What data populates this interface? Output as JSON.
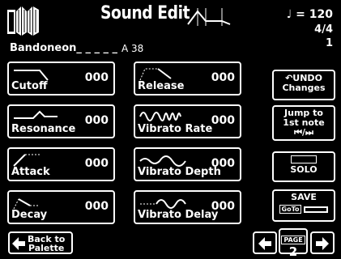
{
  "header": {
    "title": "Sound Edit",
    "tempo_label": "♩ = 120",
    "time_signature": "4/4",
    "measure": "1",
    "preset_name": "Bandoneon_ _ _ _ _",
    "preset_number": "A 38"
  },
  "params": [
    {
      "label": "Cutoff",
      "value": "000"
    },
    {
      "label": "Resonance",
      "value": "000"
    },
    {
      "label": "Attack",
      "value": "000"
    },
    {
      "label": "Decay",
      "value": "000"
    },
    {
      "label": "Release",
      "value": "000"
    },
    {
      "label": "Vibrato Rate",
      "value": "000"
    },
    {
      "label": "Vibrato Depth",
      "value": "000"
    },
    {
      "label": "Vibrato Delay",
      "value": "000"
    }
  ],
  "side": {
    "undo_line1": "UNDO",
    "undo_line2": "Changes",
    "jump_line1": "Jump to",
    "jump_line2": "1st note",
    "jump_line3": "⏮/⏭",
    "solo": "SOLO",
    "save": "SAVE",
    "goto": "GoTo"
  },
  "footer": {
    "back_line1": "Back to",
    "back_line2": "Palette",
    "page_label": "PAGE",
    "page_number": "2"
  }
}
